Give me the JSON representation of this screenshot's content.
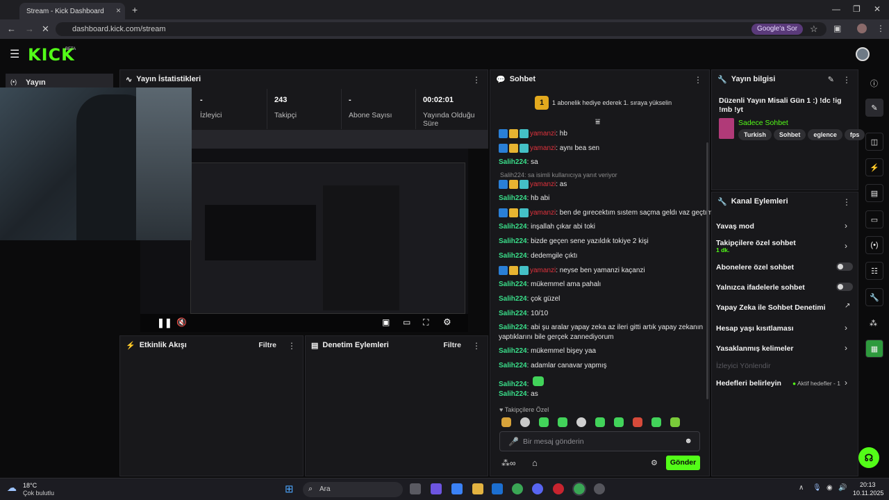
{
  "browser": {
    "tab_title": "Stream - Kick Dashboard",
    "url": "dashboard.kick.com/stream",
    "google_sor": "Google'a Sor"
  },
  "kick": {
    "logo": "KICK",
    "beta": "BETA"
  },
  "sidebar": {
    "yayin": "Yayın"
  },
  "stats": {
    "title": "Yayın İstatistikleri",
    "items": [
      {
        "value": "-",
        "label": "İzleyici"
      },
      {
        "value": "243",
        "label": "Takipçi"
      },
      {
        "value": "-",
        "label": "Abone Sayısı"
      },
      {
        "value": "00:02:01",
        "label": "Yayında Olduğu Süre"
      }
    ]
  },
  "activity": {
    "title": "Etkinlik Akışı",
    "filter": "Filtre"
  },
  "moderation": {
    "title": "Denetim Eylemleri",
    "filter": "Filtre"
  },
  "chat": {
    "title": "Sohbet",
    "gift_rank": "1",
    "gift_text": "1 abonelik hediye ederek 1. sıraya yükselin",
    "reply_text": "Salih224: sa isimli kullanıcıya yanıt veriyor",
    "messages": [
      {
        "user": "yamanzi",
        "text": ": hb"
      },
      {
        "user": "yamanzi",
        "text": ": aynı bea sen"
      },
      {
        "user": "Salih224",
        "text": ": sa"
      },
      {
        "user": "yamanzi",
        "text": ": as"
      },
      {
        "user": "Salih224",
        "text": ": hb abi"
      },
      {
        "user": "yamanzi",
        "text": ": ben de gırecektım sıstem saçma geldı vaz geçtım"
      },
      {
        "user": "Salih224",
        "text": ": inşallah çıkar abi toki"
      },
      {
        "user": "Salih224",
        "text": ": bizde geçen sene yazıldık tokiye 2 kişi"
      },
      {
        "user": "Salih224",
        "text": ": dedemgile çıktı"
      },
      {
        "user": "yamanzi",
        "text": ": neyse ben yamanzi kaçanzi"
      },
      {
        "user": "Salih224",
        "text": ": mükemmel ama pahalı"
      },
      {
        "user": "Salih224",
        "text": ": çok güzel"
      },
      {
        "user": "Salih224",
        "text": ": 10/10"
      },
      {
        "user": "Salih224",
        "text": ": abi şu aralar yapay zeka az ileri gitti artık yapay zekanın"
      },
      {
        "user": "",
        "text": "yaptıklarını bile gerçek zannediyorum"
      },
      {
        "user": "Salih224",
        "text": ": mükemmel bişey yaa"
      },
      {
        "user": "Salih224",
        "text": ": adamlar canavar yapmış"
      },
      {
        "user": "Salih224",
        "text": ":"
      },
      {
        "user": "Salih224",
        "text": ": as"
      }
    ],
    "followers_only": "Takipçilere Özel",
    "input_placeholder": "Bir mesaj gönderin",
    "send": "Gönder"
  },
  "streaminfo": {
    "title": "Yayın bilgisi",
    "stream_title": "Düzenli Yayın Misali Gün 1 :) !dc !ig !mb !yt",
    "category": "Sadece Sohbet",
    "tags": [
      "Turkish",
      "Sohbet",
      "eglence",
      "fps"
    ]
  },
  "channel_actions": {
    "title": "Kanal Eylemleri",
    "items": [
      "Yavaş mod",
      "Takipçilere özel sohbet",
      "1 dk.",
      "Abonelere özel sohbet",
      "Yalnızca ifadelerle sohbet",
      "Yapay Zeka ile Sohbet Denetimi",
      "Hesap yaşı kısıtlaması",
      "Yasaklanmış kelimeler",
      "İzleyici Yönlendir",
      "Hedefleri belirleyin",
      "Aktif hedefler - 1"
    ]
  },
  "taskbar": {
    "temp": "18°C",
    "weather": "Çok bulutlu",
    "search": "Ara",
    "time": "20:13",
    "date": "10.11.2025"
  }
}
